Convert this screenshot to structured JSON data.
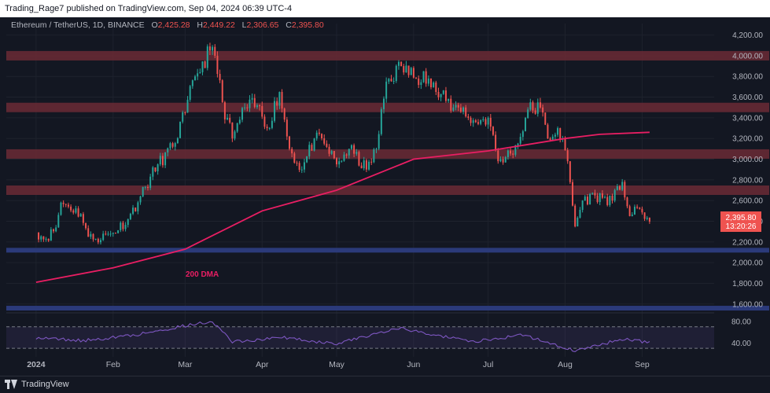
{
  "header": {
    "published": "Trading_Rage7 published on TradingView.com, Sep 04, 2024 06:39 UTC-4"
  },
  "symbol": {
    "name": "Ethereum / TetherUS, 1D, BINANCE",
    "o_label": "O",
    "o": "2,425.28",
    "h_label": "H",
    "h": "2,449.22",
    "l_label": "L",
    "l": "2,306.65",
    "c_label": "C",
    "c": "2,395.80"
  },
  "price_badge": {
    "price": "2,395.80",
    "countdown": "13:20:26"
  },
  "annotation": "200 DMA",
  "footer": {
    "brand": "TradingView"
  },
  "colors": {
    "up": "#26a69a",
    "down": "#ef5350",
    "ma": "#e91e63",
    "zone": "#6b2a35",
    "support": "#2b3a7a",
    "rsi": "#7e57c2"
  },
  "chart_data": {
    "type": "candlestick",
    "title": "Ethereum / TetherUS, 1D, BINANCE",
    "y_axis": {
      "ticks": [
        "4,200.00",
        "4,000.00",
        "3,800.00",
        "3,600.00",
        "3,400.00",
        "3,200.00",
        "3,000.00",
        "2,800.00",
        "2,600.00",
        "2,400.00",
        "2,200.00",
        "2,000.00",
        "1,800.00",
        "1,600.00"
      ],
      "range": [
        1530,
        4250
      ]
    },
    "x_axis": {
      "ticks": [
        "2024",
        "Feb",
        "Mar",
        "Apr",
        "May",
        "Jun",
        "Jul",
        "Aug",
        "Sep"
      ]
    },
    "resistance_zones": [
      4000,
      3500,
      3050,
      2700
    ],
    "support_lines": [
      2120,
      1560
    ],
    "anchors": [
      {
        "date": "2024-01-01",
        "close": 2290
      },
      {
        "date": "2024-01-05",
        "close": 2230
      },
      {
        "date": "2024-01-09",
        "close": 2340
      },
      {
        "date": "2024-01-11",
        "close": 2580
      },
      {
        "date": "2024-01-13",
        "close": 2560
      },
      {
        "date": "2024-01-19",
        "close": 2470
      },
      {
        "date": "2024-01-22",
        "close": 2250
      },
      {
        "date": "2024-01-25",
        "close": 2230
      },
      {
        "date": "2024-02-01",
        "close": 2290
      },
      {
        "date": "2024-02-07",
        "close": 2420
      },
      {
        "date": "2024-02-12",
        "close": 2640
      },
      {
        "date": "2024-02-19",
        "close": 2950
      },
      {
        "date": "2024-02-25",
        "close": 3120
      },
      {
        "date": "2024-03-01",
        "close": 3450
      },
      {
        "date": "2024-03-05",
        "close": 3800
      },
      {
        "date": "2024-03-11",
        "close": 4050
      },
      {
        "date": "2024-03-13",
        "close": 4000
      },
      {
        "date": "2024-03-16",
        "close": 3550
      },
      {
        "date": "2024-03-20",
        "close": 3200
      },
      {
        "date": "2024-03-25",
        "close": 3500
      },
      {
        "date": "2024-03-30",
        "close": 3520
      },
      {
        "date": "2024-04-03",
        "close": 3300
      },
      {
        "date": "2024-04-08",
        "close": 3650
      },
      {
        "date": "2024-04-12",
        "close": 3100
      },
      {
        "date": "2024-04-17",
        "close": 2900
      },
      {
        "date": "2024-04-22",
        "close": 3200
      },
      {
        "date": "2024-04-26",
        "close": 3150
      },
      {
        "date": "2024-05-01",
        "close": 2950
      },
      {
        "date": "2024-05-06",
        "close": 3100
      },
      {
        "date": "2024-05-13",
        "close": 2900
      },
      {
        "date": "2024-05-17",
        "close": 3100
      },
      {
        "date": "2024-05-21",
        "close": 3750
      },
      {
        "date": "2024-05-27",
        "close": 3900
      },
      {
        "date": "2024-06-02",
        "close": 3780
      },
      {
        "date": "2024-06-05",
        "close": 3850
      },
      {
        "date": "2024-06-10",
        "close": 3650
      },
      {
        "date": "2024-06-17",
        "close": 3500
      },
      {
        "date": "2024-06-21",
        "close": 3500
      },
      {
        "date": "2024-06-24",
        "close": 3350
      },
      {
        "date": "2024-07-01",
        "close": 3400
      },
      {
        "date": "2024-07-05",
        "close": 2980
      },
      {
        "date": "2024-07-08",
        "close": 3020
      },
      {
        "date": "2024-07-13",
        "close": 3150
      },
      {
        "date": "2024-07-17",
        "close": 3480
      },
      {
        "date": "2024-07-22",
        "close": 3500
      },
      {
        "date": "2024-07-25",
        "close": 3200
      },
      {
        "date": "2024-07-29",
        "close": 3300
      },
      {
        "date": "2024-08-02",
        "close": 2980
      },
      {
        "date": "2024-08-05",
        "close": 2350
      },
      {
        "date": "2024-08-08",
        "close": 2600
      },
      {
        "date": "2024-08-13",
        "close": 2650
      },
      {
        "date": "2024-08-20",
        "close": 2600
      },
      {
        "date": "2024-08-24",
        "close": 2780
      },
      {
        "date": "2024-08-27",
        "close": 2450
      },
      {
        "date": "2024-08-31",
        "close": 2520
      },
      {
        "date": "2024-09-04",
        "close": 2395.8
      }
    ],
    "ma_200": [
      {
        "date": "2024-01-01",
        "value": 1810
      },
      {
        "date": "2024-02-01",
        "value": 1950
      },
      {
        "date": "2024-03-01",
        "value": 2130
      },
      {
        "date": "2024-04-01",
        "value": 2500
      },
      {
        "date": "2024-05-01",
        "value": 2700
      },
      {
        "date": "2024-06-01",
        "value": 3000
      },
      {
        "date": "2024-07-01",
        "value": 3080
      },
      {
        "date": "2024-08-01",
        "value": 3200
      },
      {
        "date": "2024-08-15",
        "value": 3240
      },
      {
        "date": "2024-09-04",
        "value": 3260
      }
    ],
    "rsi": {
      "ticks": [
        "80.00",
        "40.00"
      ],
      "range": [
        20,
        90
      ],
      "bands": [
        70,
        30
      ],
      "series": [
        {
          "date": "2024-01-01",
          "value": 50
        },
        {
          "date": "2024-01-20",
          "value": 44
        },
        {
          "date": "2024-02-10",
          "value": 55
        },
        {
          "date": "2024-03-01",
          "value": 72
        },
        {
          "date": "2024-03-12",
          "value": 80
        },
        {
          "date": "2024-03-20",
          "value": 42
        },
        {
          "date": "2024-04-10",
          "value": 50
        },
        {
          "date": "2024-05-01",
          "value": 38
        },
        {
          "date": "2024-05-25",
          "value": 68
        },
        {
          "date": "2024-06-25",
          "value": 42
        },
        {
          "date": "2024-07-15",
          "value": 55
        },
        {
          "date": "2024-08-05",
          "value": 25
        },
        {
          "date": "2024-08-25",
          "value": 48
        },
        {
          "date": "2024-09-04",
          "value": 40
        }
      ]
    }
  }
}
